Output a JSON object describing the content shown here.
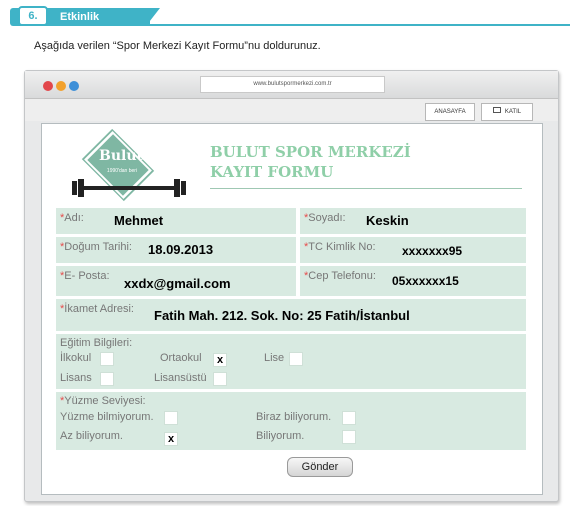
{
  "activity": {
    "number": "6.",
    "title": "Etkinlik"
  },
  "instruction": "Aşağıda verilen “Spor Merkezi Kayıt Formu”nu doldurunuz.",
  "browser": {
    "url": "www.bulutspormerkezi.com.tr",
    "home_button": "ANASAYFA",
    "join_button": "KATIL"
  },
  "logo": {
    "name": "Bulut",
    "since": "1990'dan beri"
  },
  "site_title": {
    "line1": "BULUT SPOR MERKEZİ",
    "line2": "KAYIT FORMU"
  },
  "form": {
    "name": {
      "label": "Adı:",
      "value": "Mehmet"
    },
    "surname": {
      "label": "Soyadı:",
      "value": "Keskin"
    },
    "birth_date": {
      "label": "Doğum Tarihi:",
      "value": "18.09.2013"
    },
    "tc_no": {
      "label": "TC Kimlik No:",
      "value": "xxxxxxx95"
    },
    "email": {
      "label": "E- Posta:",
      "value": "xxdx@gmail.com"
    },
    "phone": {
      "label": "Cep Telefonu:",
      "value": "05xxxxxx15"
    },
    "address": {
      "label": "İkamet Adresi:",
      "value": "Fatih Mah. 212. Sok. No: 25 Fatih/İstanbul"
    },
    "education": {
      "label": "Eğitim Bilgileri:",
      "options": {
        "ilkokul": {
          "label": "İlkokul",
          "mark": ""
        },
        "ortaokul": {
          "label": "Ortaokul",
          "mark": "x"
        },
        "lise": {
          "label": "Lise",
          "mark": ""
        },
        "lisans": {
          "label": "Lisans",
          "mark": ""
        },
        "lisansustu": {
          "label": "Lisansüstü",
          "mark": ""
        }
      }
    },
    "swimming": {
      "label": "Yüzme Seviyesi:",
      "options": {
        "none": {
          "label": "Yüzme bilmiyorum.",
          "mark": ""
        },
        "some": {
          "label": "Biraz biliyorum.",
          "mark": ""
        },
        "little": {
          "label": "Az biliyorum.",
          "mark": "x"
        },
        "knows": {
          "label": "Biliyorum.",
          "mark": ""
        }
      }
    },
    "required_mark": "*",
    "submit": "Gönder"
  }
}
